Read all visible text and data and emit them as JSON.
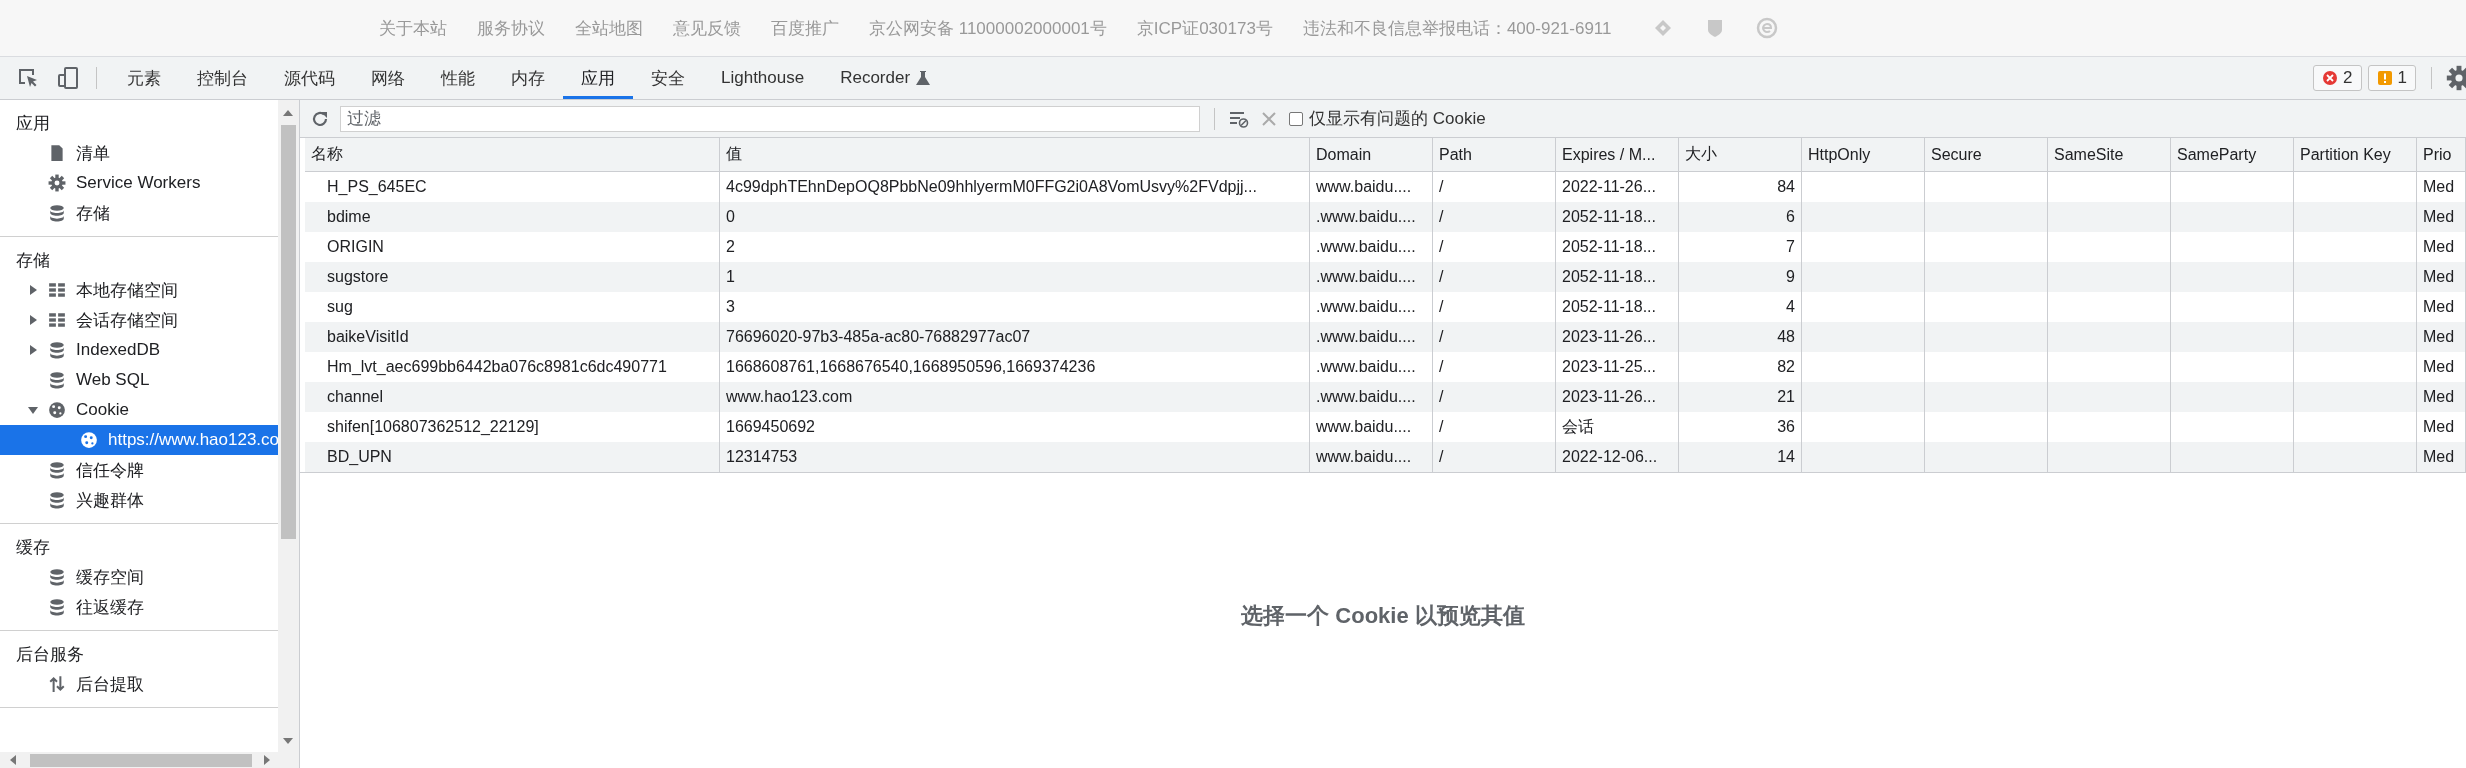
{
  "page_footer": {
    "links": [
      "关于本站",
      "服务协议",
      "全站地图",
      "意见反馈",
      "百度推广",
      "京公网安备 11000002000001号",
      "京ICP证030173号",
      "违法和不良信息举报电话：400-921-6911"
    ]
  },
  "devtools": {
    "tabs": [
      {
        "label": "元素",
        "kind": "plain",
        "selected": false
      },
      {
        "label": "控制台",
        "kind": "plain",
        "selected": false
      },
      {
        "label": "源代码",
        "kind": "plain",
        "selected": false
      },
      {
        "label": "网络",
        "kind": "plain",
        "selected": false
      },
      {
        "label": "性能",
        "kind": "plain",
        "selected": false
      },
      {
        "label": "内存",
        "kind": "plain",
        "selected": false
      },
      {
        "label": "应用",
        "kind": "plain",
        "selected": true
      },
      {
        "label": "安全",
        "kind": "plain",
        "selected": false
      },
      {
        "label": "Lighthouse",
        "kind": "plain",
        "selected": false
      },
      {
        "label": "Recorder",
        "kind": "experiment",
        "selected": false
      }
    ],
    "error_count": "2",
    "warning_count": "1"
  },
  "sidebar": {
    "sections": [
      {
        "title": "应用",
        "items": [
          {
            "label": "清单",
            "kind": "file",
            "selected": false
          },
          {
            "label": "Service Workers",
            "kind": "gear",
            "selected": false
          },
          {
            "label": "存储",
            "kind": "database",
            "selected": false
          }
        ]
      },
      {
        "title": "存储",
        "items": [
          {
            "label": "本地存储空间",
            "kind": "grid",
            "expanded": false,
            "selected": false
          },
          {
            "label": "会话存储空间",
            "kind": "grid",
            "expanded": false,
            "selected": false
          },
          {
            "label": "IndexedDB",
            "kind": "database",
            "expanded": false,
            "selected": false
          },
          {
            "label": "Web SQL",
            "kind": "database",
            "selected": false
          },
          {
            "label": "Cookie",
            "kind": "cookie",
            "expanded": true,
            "selected": false,
            "children": [
              {
                "label": "https://www.hao123.co",
                "kind": "cookie",
                "selected": true
              }
            ]
          },
          {
            "label": "信任令牌",
            "kind": "database",
            "selected": false
          },
          {
            "label": "兴趣群体",
            "kind": "database",
            "selected": false
          }
        ]
      },
      {
        "title": "缓存",
        "items": [
          {
            "label": "缓存空间",
            "kind": "database",
            "selected": false
          },
          {
            "label": "往返缓存",
            "kind": "database",
            "selected": false
          }
        ]
      },
      {
        "title": "后台服务",
        "items": [
          {
            "label": "后台提取",
            "kind": "fetch",
            "selected": false
          }
        ]
      }
    ]
  },
  "toolbar": {
    "filter": {
      "placeholder": "过滤"
    },
    "issues_only": {
      "label": "仅显示有问题的 Cookie",
      "checked": false
    }
  },
  "table": {
    "columns": [
      "名称",
      "值",
      "Domain",
      "Path",
      "Expires / M...",
      "大小",
      "HttpOnly",
      "Secure",
      "SameSite",
      "SameParty",
      "Partition Key",
      "Prio"
    ],
    "rows": [
      {
        "name": "H_PS_645EC",
        "value": "4c99dphTEhnDepOQ8PbbNe09hhlyermM0FFG2i0A8VomUsvy%2FVdpjj...",
        "domain": "www.baidu....",
        "path": "/",
        "expires": "2022-11-26...",
        "size": "84",
        "priority": "Med"
      },
      {
        "name": "bdime",
        "value": "0",
        "domain": ".www.baidu....",
        "path": "/",
        "expires": "2052-11-18...",
        "size": "6",
        "priority": "Med"
      },
      {
        "name": "ORIGIN",
        "value": "2",
        "domain": ".www.baidu....",
        "path": "/",
        "expires": "2052-11-18...",
        "size": "7",
        "priority": "Med"
      },
      {
        "name": "sugstore",
        "value": "1",
        "domain": ".www.baidu....",
        "path": "/",
        "expires": "2052-11-18...",
        "size": "9",
        "priority": "Med"
      },
      {
        "name": "sug",
        "value": "3",
        "domain": ".www.baidu....",
        "path": "/",
        "expires": "2052-11-18...",
        "size": "4",
        "priority": "Med"
      },
      {
        "name": "baikeVisitId",
        "value": "76696020-97b3-485a-ac80-76882977ac07",
        "domain": ".www.baidu....",
        "path": "/",
        "expires": "2023-11-26...",
        "size": "48",
        "priority": "Med"
      },
      {
        "name": "Hm_lvt_aec699bb6442ba076c8981c6dc490771",
        "value": "1668608761,1668676540,1668950596,1669374236",
        "domain": ".www.baidu....",
        "path": "/",
        "expires": "2023-11-25...",
        "size": "82",
        "priority": "Med"
      },
      {
        "name": "channel",
        "value": "www.hao123.com",
        "domain": ".www.baidu....",
        "path": "/",
        "expires": "2023-11-26...",
        "size": "21",
        "priority": "Med"
      },
      {
        "name": "shifen[106807362512_22129]",
        "value": "1669450692",
        "domain": "www.baidu....",
        "path": "/",
        "expires": "会话",
        "size": "36",
        "priority": "Med"
      },
      {
        "name": "BD_UPN",
        "value": "12314753",
        "domain": "www.baidu....",
        "path": "/",
        "expires": "2022-12-06...",
        "size": "14",
        "priority": "Med"
      }
    ]
  },
  "preview": {
    "message": "选择一个 Cookie 以预览其值"
  }
}
